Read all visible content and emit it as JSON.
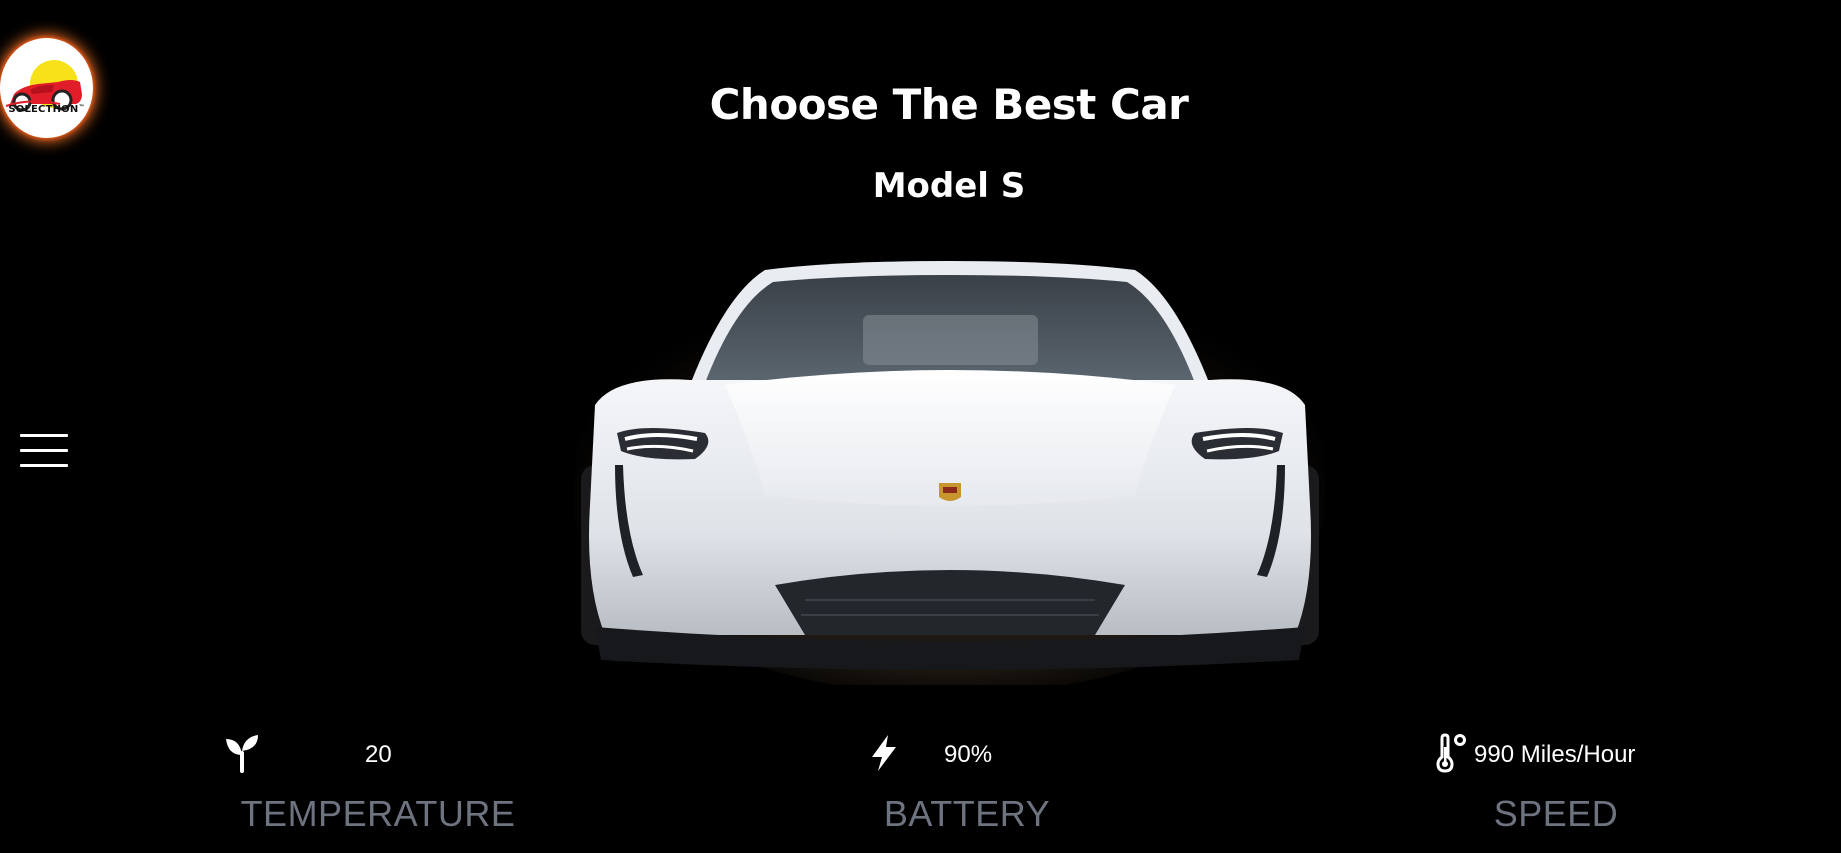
{
  "logo": {
    "text": "SOLECTHON",
    "trademark": "™"
  },
  "header": {
    "title": "Choose The Best Car",
    "model": "Model S"
  },
  "car": {
    "icon": "car-front-image"
  },
  "stats": [
    {
      "icon": "sprout-icon",
      "value": "20",
      "label": "TEMPERATURE"
    },
    {
      "icon": "bolt-icon",
      "value": "90%",
      "label": "BATTERY"
    },
    {
      "icon": "thermometer-degree-icon",
      "value": "990 Miles/Hour",
      "label": "SPEED"
    }
  ],
  "colors": {
    "background": "#000000",
    "text": "#ffffff",
    "label": "#6d7480",
    "logo_glow": "#ff7828",
    "logo_yellow": "#f7e21a",
    "logo_red": "#e11d2a"
  }
}
